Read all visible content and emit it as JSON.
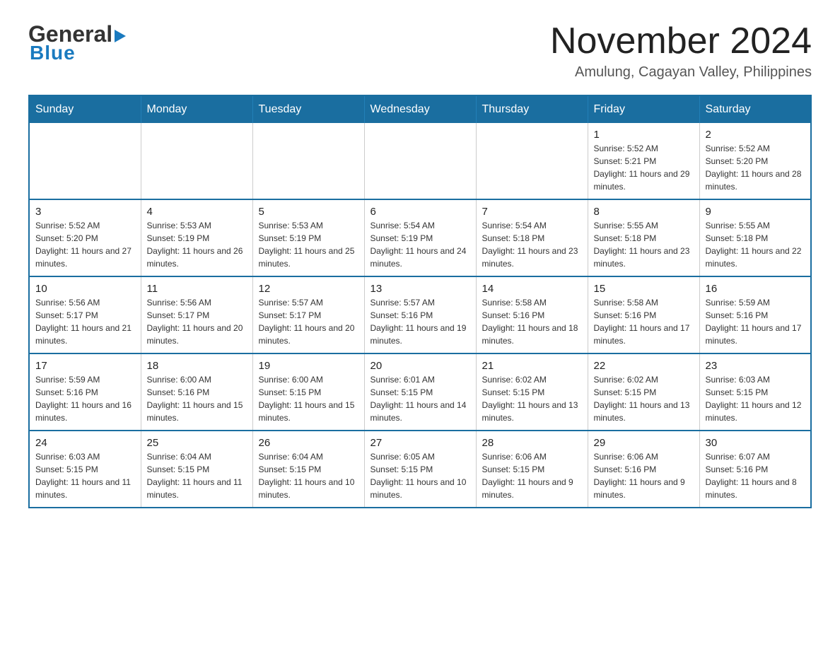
{
  "header": {
    "logo": {
      "general": "General",
      "blue": "Blue",
      "arrow_color": "#1a7abf"
    },
    "title": "November 2024",
    "location": "Amulung, Cagayan Valley, Philippines"
  },
  "calendar": {
    "days_of_week": [
      "Sunday",
      "Monday",
      "Tuesday",
      "Wednesday",
      "Thursday",
      "Friday",
      "Saturday"
    ],
    "weeks": [
      [
        {
          "day": "",
          "info": ""
        },
        {
          "day": "",
          "info": ""
        },
        {
          "day": "",
          "info": ""
        },
        {
          "day": "",
          "info": ""
        },
        {
          "day": "",
          "info": ""
        },
        {
          "day": "1",
          "info": "Sunrise: 5:52 AM\nSunset: 5:21 PM\nDaylight: 11 hours and 29 minutes."
        },
        {
          "day": "2",
          "info": "Sunrise: 5:52 AM\nSunset: 5:20 PM\nDaylight: 11 hours and 28 minutes."
        }
      ],
      [
        {
          "day": "3",
          "info": "Sunrise: 5:52 AM\nSunset: 5:20 PM\nDaylight: 11 hours and 27 minutes."
        },
        {
          "day": "4",
          "info": "Sunrise: 5:53 AM\nSunset: 5:19 PM\nDaylight: 11 hours and 26 minutes."
        },
        {
          "day": "5",
          "info": "Sunrise: 5:53 AM\nSunset: 5:19 PM\nDaylight: 11 hours and 25 minutes."
        },
        {
          "day": "6",
          "info": "Sunrise: 5:54 AM\nSunset: 5:19 PM\nDaylight: 11 hours and 24 minutes."
        },
        {
          "day": "7",
          "info": "Sunrise: 5:54 AM\nSunset: 5:18 PM\nDaylight: 11 hours and 23 minutes."
        },
        {
          "day": "8",
          "info": "Sunrise: 5:55 AM\nSunset: 5:18 PM\nDaylight: 11 hours and 23 minutes."
        },
        {
          "day": "9",
          "info": "Sunrise: 5:55 AM\nSunset: 5:18 PM\nDaylight: 11 hours and 22 minutes."
        }
      ],
      [
        {
          "day": "10",
          "info": "Sunrise: 5:56 AM\nSunset: 5:17 PM\nDaylight: 11 hours and 21 minutes."
        },
        {
          "day": "11",
          "info": "Sunrise: 5:56 AM\nSunset: 5:17 PM\nDaylight: 11 hours and 20 minutes."
        },
        {
          "day": "12",
          "info": "Sunrise: 5:57 AM\nSunset: 5:17 PM\nDaylight: 11 hours and 20 minutes."
        },
        {
          "day": "13",
          "info": "Sunrise: 5:57 AM\nSunset: 5:16 PM\nDaylight: 11 hours and 19 minutes."
        },
        {
          "day": "14",
          "info": "Sunrise: 5:58 AM\nSunset: 5:16 PM\nDaylight: 11 hours and 18 minutes."
        },
        {
          "day": "15",
          "info": "Sunrise: 5:58 AM\nSunset: 5:16 PM\nDaylight: 11 hours and 17 minutes."
        },
        {
          "day": "16",
          "info": "Sunrise: 5:59 AM\nSunset: 5:16 PM\nDaylight: 11 hours and 17 minutes."
        }
      ],
      [
        {
          "day": "17",
          "info": "Sunrise: 5:59 AM\nSunset: 5:16 PM\nDaylight: 11 hours and 16 minutes."
        },
        {
          "day": "18",
          "info": "Sunrise: 6:00 AM\nSunset: 5:16 PM\nDaylight: 11 hours and 15 minutes."
        },
        {
          "day": "19",
          "info": "Sunrise: 6:00 AM\nSunset: 5:15 PM\nDaylight: 11 hours and 15 minutes."
        },
        {
          "day": "20",
          "info": "Sunrise: 6:01 AM\nSunset: 5:15 PM\nDaylight: 11 hours and 14 minutes."
        },
        {
          "day": "21",
          "info": "Sunrise: 6:02 AM\nSunset: 5:15 PM\nDaylight: 11 hours and 13 minutes."
        },
        {
          "day": "22",
          "info": "Sunrise: 6:02 AM\nSunset: 5:15 PM\nDaylight: 11 hours and 13 minutes."
        },
        {
          "day": "23",
          "info": "Sunrise: 6:03 AM\nSunset: 5:15 PM\nDaylight: 11 hours and 12 minutes."
        }
      ],
      [
        {
          "day": "24",
          "info": "Sunrise: 6:03 AM\nSunset: 5:15 PM\nDaylight: 11 hours and 11 minutes."
        },
        {
          "day": "25",
          "info": "Sunrise: 6:04 AM\nSunset: 5:15 PM\nDaylight: 11 hours and 11 minutes."
        },
        {
          "day": "26",
          "info": "Sunrise: 6:04 AM\nSunset: 5:15 PM\nDaylight: 11 hours and 10 minutes."
        },
        {
          "day": "27",
          "info": "Sunrise: 6:05 AM\nSunset: 5:15 PM\nDaylight: 11 hours and 10 minutes."
        },
        {
          "day": "28",
          "info": "Sunrise: 6:06 AM\nSunset: 5:15 PM\nDaylight: 11 hours and 9 minutes."
        },
        {
          "day": "29",
          "info": "Sunrise: 6:06 AM\nSunset: 5:16 PM\nDaylight: 11 hours and 9 minutes."
        },
        {
          "day": "30",
          "info": "Sunrise: 6:07 AM\nSunset: 5:16 PM\nDaylight: 11 hours and 8 minutes."
        }
      ]
    ]
  }
}
